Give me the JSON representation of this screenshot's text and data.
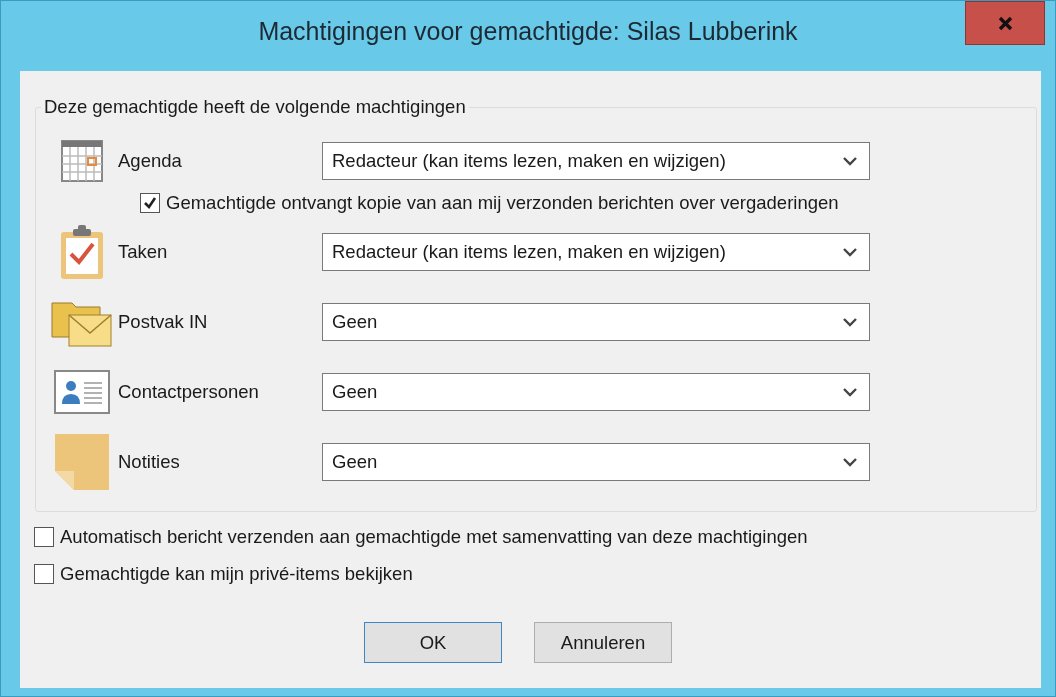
{
  "window": {
    "title": "Machtigingen voor gemachtigde: Silas Lubberink"
  },
  "group": {
    "legend": "Deze gemachtigde heeft de volgende machtigingen",
    "folders": [
      {
        "kind": "calendar",
        "label": "Agenda",
        "value": "Redacteur (kan items lezen, maken en wijzigen)",
        "option": {
          "label": "Gemachtigde ontvangt kopie van aan mij verzonden berichten over vergaderingen",
          "checked": true
        }
      },
      {
        "kind": "tasks",
        "label": "Taken",
        "value": "Redacteur (kan items lezen, maken en wijzigen)"
      },
      {
        "kind": "inbox",
        "label": "Postvak IN",
        "value": "Geen"
      },
      {
        "kind": "contacts",
        "label": "Contactpersonen",
        "value": "Geen"
      },
      {
        "kind": "notes",
        "label": "Notities",
        "value": "Geen"
      }
    ]
  },
  "options": [
    {
      "label": "Automatisch bericht verzenden aan gemachtigde met samenvatting van deze machtigingen",
      "checked": false
    },
    {
      "label": "Gemachtigde kan mijn privé-items bekijken",
      "checked": false
    }
  ],
  "buttons": [
    {
      "label": "OK",
      "default": true
    },
    {
      "label": "Annuleren",
      "default": false
    }
  ]
}
